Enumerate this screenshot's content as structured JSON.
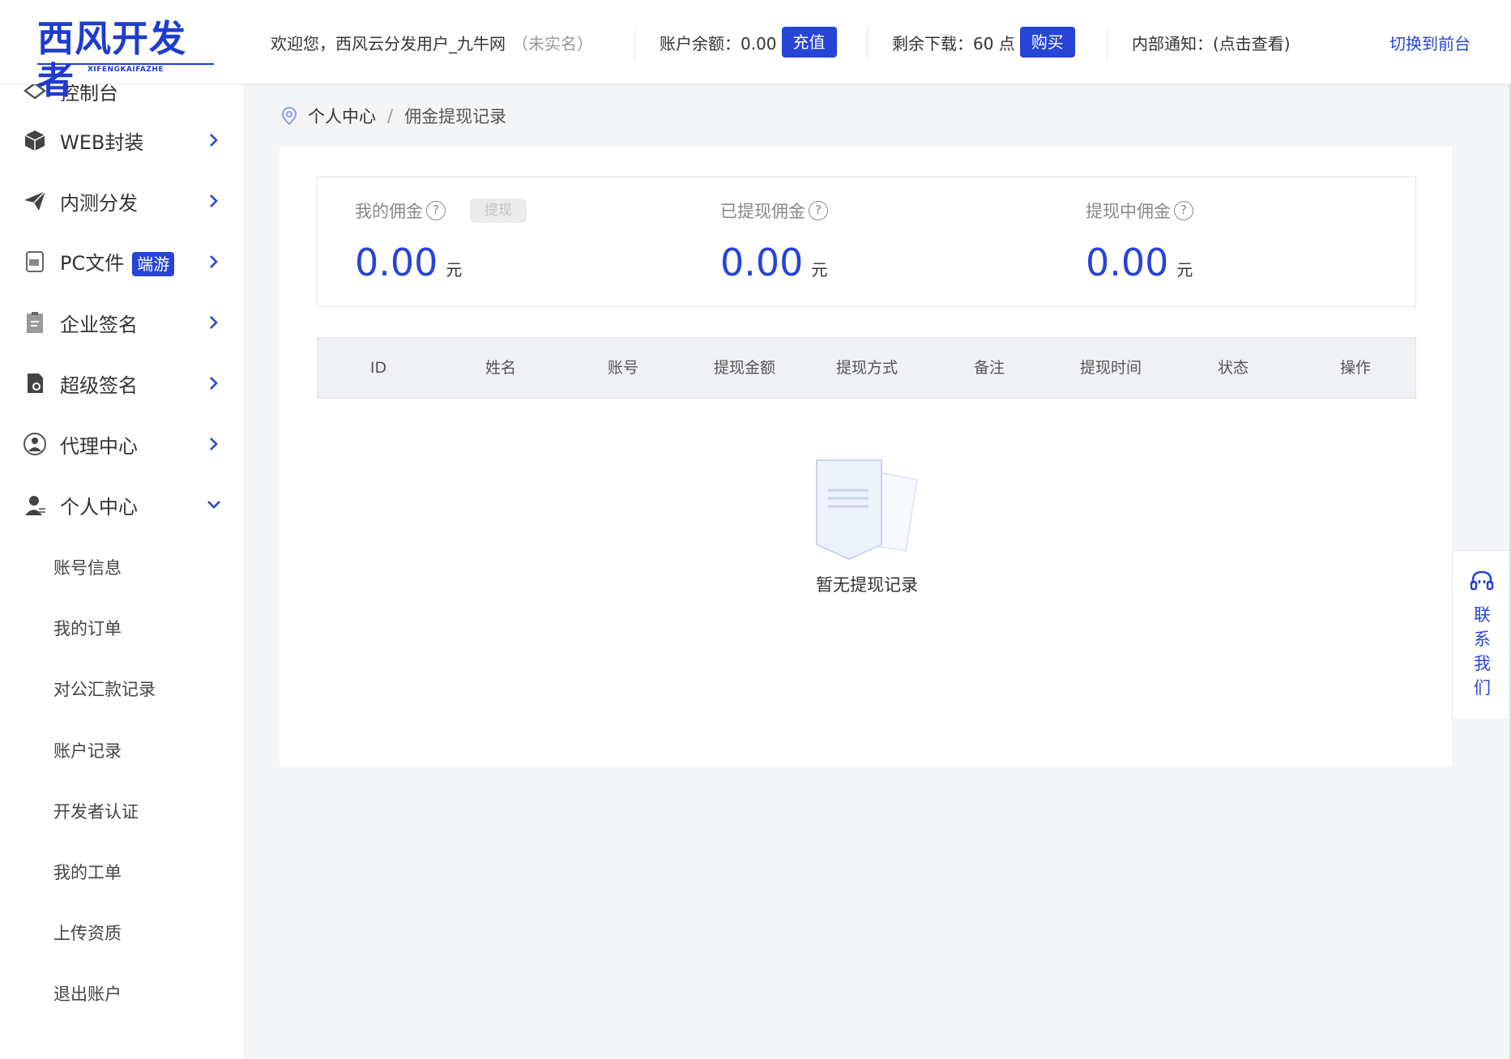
{
  "header": {
    "logo_text": "西风开发者",
    "logo_sub": "XIFENGKAIFAZHE",
    "welcome": "欢迎您，西风云分发用户_九牛网",
    "realname_status": "（未实名）",
    "balance_label": "账户余额：0.00",
    "recharge_button": "充值",
    "downloads_label": "剩余下载：60 点",
    "buy_button": "购买",
    "notice_label": "内部通知：(点击查看)",
    "switch_link": "切换到前台"
  },
  "sidebar": {
    "items": [
      {
        "label": "控制台",
        "icon": "dashboard-icon"
      },
      {
        "label": "WEB封装",
        "icon": "box-icon"
      },
      {
        "label": "内测分发",
        "icon": "paper-plane-icon"
      },
      {
        "label": "PC文件",
        "badge": "端游",
        "icon": "pc-file-icon"
      },
      {
        "label": "企业签名",
        "icon": "clipboard-icon"
      },
      {
        "label": "超级签名",
        "icon": "certificate-icon"
      },
      {
        "label": "代理中心",
        "icon": "agent-icon"
      },
      {
        "label": "个人中心",
        "icon": "user-icon"
      }
    ],
    "sub_items": [
      "账号信息",
      "我的订单",
      "对公汇款记录",
      "账户记录",
      "开发者认证",
      "我的工单",
      "上传资质",
      "退出账户"
    ]
  },
  "breadcrumb": {
    "parent": "个人中心",
    "separator": "/",
    "current": "佣金提现记录"
  },
  "stats": {
    "my_commission": {
      "title": "我的佣金",
      "value": "0.00",
      "unit": "元",
      "button": "提现"
    },
    "withdrawn": {
      "title": "已提现佣金",
      "value": "0.00",
      "unit": "元"
    },
    "withdrawing": {
      "title": "提现中佣金",
      "value": "0.00",
      "unit": "元"
    },
    "help_glyph": "?"
  },
  "table": {
    "columns": [
      "ID",
      "姓名",
      "账号",
      "提现金额",
      "提现方式",
      "备注",
      "提现时间",
      "状态",
      "操作"
    ],
    "rows": [],
    "empty_text": "暂无提现记录"
  },
  "contact": {
    "label": "联系我们",
    "chars": [
      "联",
      "系",
      "我",
      "们"
    ]
  },
  "colors": {
    "accent": "#2744d6",
    "background": "#f4f5f7"
  }
}
